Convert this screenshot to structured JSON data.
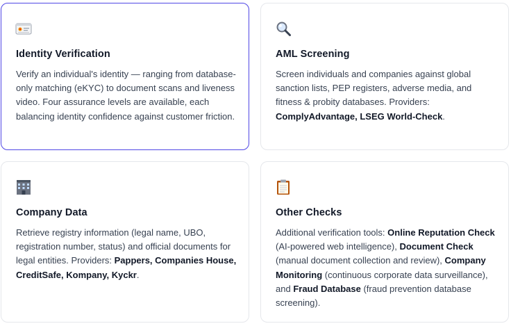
{
  "cards": [
    {
      "title": "Identity Verification",
      "icon": "id-card-icon",
      "description": "Verify an individual's identity — ranging from database-only matching (eKYC) to document scans and liveness video. Four assurance levels are available, each balancing identity confidence against customer friction.",
      "providers": ""
    },
    {
      "title": "AML Screening",
      "icon": "magnifier-icon",
      "description": "Screen individuals and companies against global sanction lists, PEP registers, adverse media, and fitness & probity databases. Providers: ",
      "providers": "ComplyAdvantage, LSEG World-Check",
      "suffix": "."
    },
    {
      "title": "Company Data",
      "icon": "office-building-icon",
      "description": "Retrieve registry information (legal name, UBO, registration number, status) and official documents for legal entities. Providers: ",
      "providers": "Pappers, Companies House, CreditSafe, Kompany, Kyckr",
      "suffix": "."
    },
    {
      "title": "Other Checks",
      "icon": "clipboard-icon",
      "intro": "Additional verification tools: ",
      "items": [
        {
          "name": "Online Reputation Check",
          "detail": " (AI-powered web intelligence), "
        },
        {
          "name": "Document Check",
          "detail": " (manual document collection and review), "
        },
        {
          "name": "Company Monitoring",
          "detail": " (continuous corporate data surveillance), and "
        },
        {
          "name": "Fraud Database",
          "detail": " (fraud prevention database screening)."
        }
      ]
    }
  ],
  "colors": {
    "active_border": "#4f46e5",
    "border": "#e5e7eb",
    "title": "#111827",
    "text": "#374151"
  }
}
